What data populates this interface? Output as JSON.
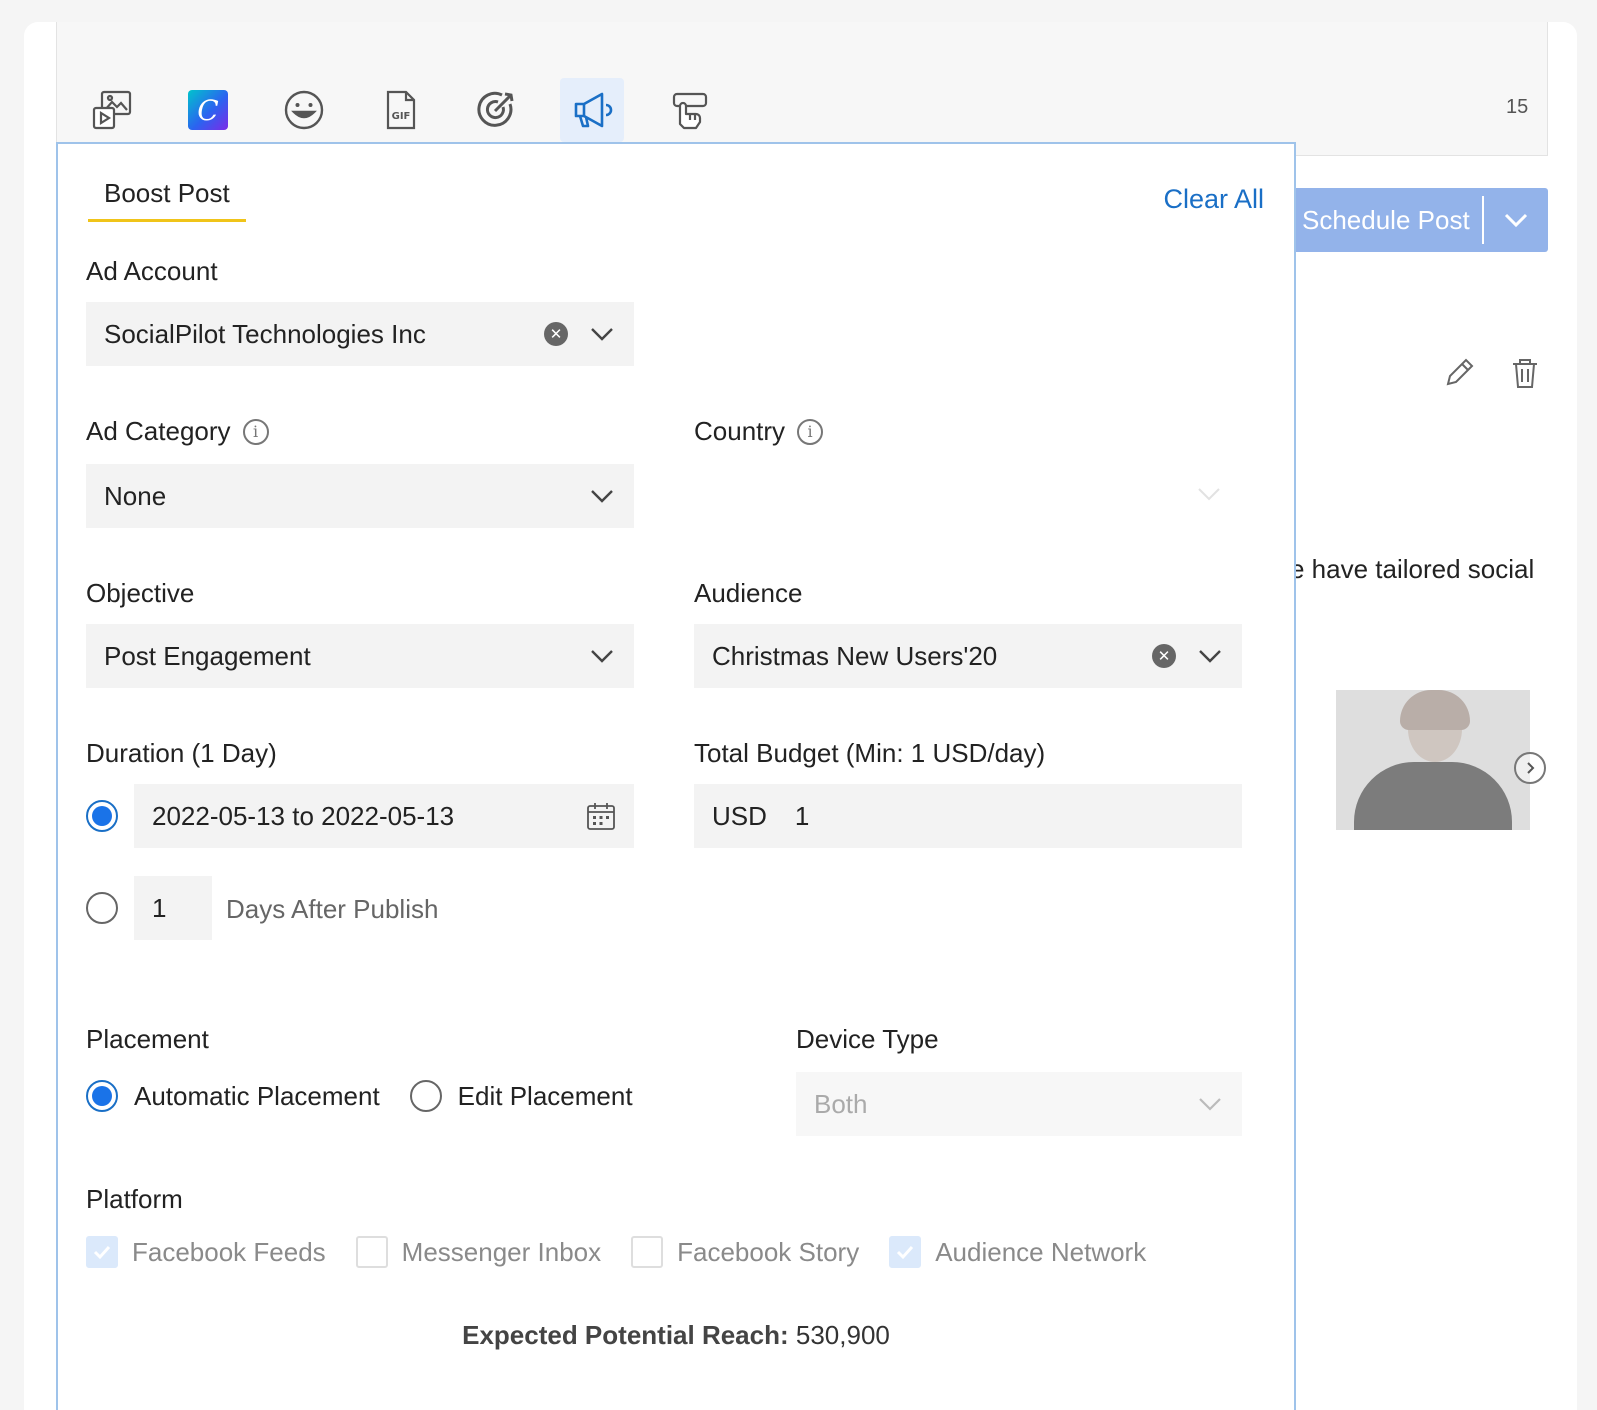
{
  "toolbar": {
    "icons": [
      "media-icon",
      "canva-icon",
      "emoji-icon",
      "gif-icon",
      "target-icon",
      "megaphone-icon",
      "hand-pointer-icon"
    ],
    "canva_letter": "C",
    "active_icon": "megaphone-icon",
    "char_count": "15"
  },
  "schedule": {
    "label": "Schedule Post"
  },
  "background": {
    "caption": "e have tailored social"
  },
  "boost": {
    "tab_label": "Boost Post",
    "clear_all": "Clear All",
    "ad_account": {
      "label": "Ad Account",
      "value": "SocialPilot Technologies Inc"
    },
    "ad_category": {
      "label": "Ad Category",
      "value": "None"
    },
    "country": {
      "label": "Country",
      "value": ""
    },
    "objective": {
      "label": "Objective",
      "value": "Post Engagement"
    },
    "audience": {
      "label": "Audience",
      "value": "Christmas New Users'20"
    },
    "duration": {
      "label": "Duration (1 Day)",
      "date_range": "2022-05-13 to 2022-05-13",
      "days_value": "1",
      "days_suffix": "Days After Publish",
      "selected": "date_range"
    },
    "budget": {
      "label": "Total Budget (Min: 1 USD/day)",
      "currency": "USD",
      "value": "1"
    },
    "placement": {
      "label": "Placement",
      "options": [
        "Automatic Placement",
        "Edit Placement"
      ],
      "selected": "Automatic Placement"
    },
    "device_type": {
      "label": "Device Type",
      "value": "Both"
    },
    "platform": {
      "label": "Platform",
      "options": [
        {
          "label": "Facebook Feeds",
          "checked": true
        },
        {
          "label": "Messenger Inbox",
          "checked": false
        },
        {
          "label": "Facebook Story",
          "checked": false
        },
        {
          "label": "Audience Network",
          "checked": true
        }
      ]
    },
    "reach": {
      "label": "Expected Potential Reach:",
      "value": "530,900"
    }
  },
  "colors": {
    "accent": "#1a73e8",
    "link": "#1a6fc6",
    "tab_underline": "#f0c419",
    "panel_border": "#9fc3ea",
    "schedule_button": "#93b3ea"
  }
}
